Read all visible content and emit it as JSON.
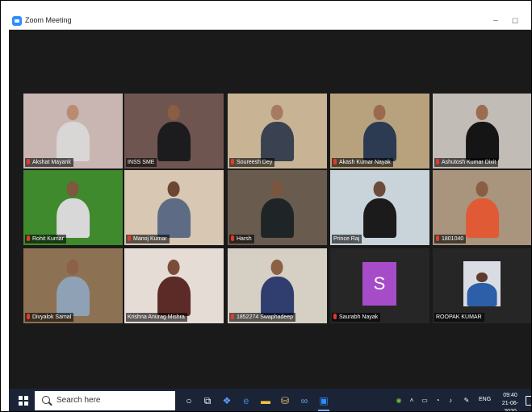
{
  "window": {
    "title": "Zoom Meeting",
    "minimize_glyph": "–",
    "maximize_glyph": "☐"
  },
  "participants": [
    {
      "name": "Akshat Mayank",
      "mic": "muted",
      "bg": "#c9b6b2",
      "skin": "#b98b72",
      "shirt": "#d9d6d6"
    },
    {
      "name": "INSS SME",
      "mic": "none",
      "bg": "#6f5550",
      "skin": "#8a5e43",
      "shirt": "#1c1c1e"
    },
    {
      "name": "Soureesh Dey",
      "mic": "muted",
      "bg": "#c8b495",
      "skin": "#a77b61",
      "shirt": "#3a4150"
    },
    {
      "name": "Akash Kumar Nayak",
      "mic": "muted",
      "bg": "#b8a27d",
      "skin": "#9a6a4f",
      "shirt": "#2c3b52"
    },
    {
      "name": "Ashutosh Kumar Dixit",
      "mic": "muted",
      "bg": "#c2bcb6",
      "skin": "#9c6c50",
      "shirt": "#151515"
    },
    {
      "name": "Rohit Kumar",
      "mic": "muted",
      "bg": "#3f8a2c",
      "skin": "#80573f",
      "shirt": "#d8d8d8"
    },
    {
      "name": "Manoj Kumar",
      "mic": "muted",
      "bg": "#d7c7b3",
      "skin": "#6a4633",
      "shirt": "#5d6c84"
    },
    {
      "name": "Harsh",
      "mic": "muted",
      "bg": "#6a5b4f",
      "skin": "#7a563e",
      "shirt": "#1f2526"
    },
    {
      "name": "Prince Raj",
      "mic": "none",
      "bg": "#c9d4da",
      "skin": "#6b4c3a",
      "shirt": "#1b1b1b"
    },
    {
      "name": "1801040",
      "mic": "muted",
      "bg": "#a9947e",
      "skin": "#8a5e43",
      "shirt": "#e05a36"
    },
    {
      "name": "Divyalok Samal",
      "mic": "muted",
      "bg": "#8c7152",
      "skin": "#8d6148",
      "shirt": "#8fa1b5"
    },
    {
      "name": "Krishna Anurag Mishra",
      "mic": "none",
      "bg": "#e6dcd6",
      "skin": "#7a4d3a",
      "shirt": "#5c2b27"
    },
    {
      "name": "1852274 Swaphadeep",
      "mic": "muted",
      "bg": "#d6cfc4",
      "skin": "#8c6045",
      "shirt": "#2f3e6e"
    },
    {
      "name": "Saurabh Nayak",
      "mic": "muted",
      "bg": "#262626",
      "skin": "",
      "shirt": "",
      "avatar_letter": "S"
    },
    {
      "name": "ROOPAK KUMAR",
      "mic": "none",
      "bg": "#262626",
      "skin": "#5b3d2e",
      "shirt": "#2d5ea8",
      "active": true
    }
  ],
  "taskbar": {
    "search_placeholder": "Search here",
    "icons": [
      "cortana-icon",
      "task-view-icon",
      "dropbox-icon",
      "edge-icon",
      "file-explorer-icon",
      "store-icon",
      "infinity-icon",
      "zoom-icon"
    ],
    "language": "ENG",
    "time": "09:40",
    "date": "21-06-2020"
  }
}
